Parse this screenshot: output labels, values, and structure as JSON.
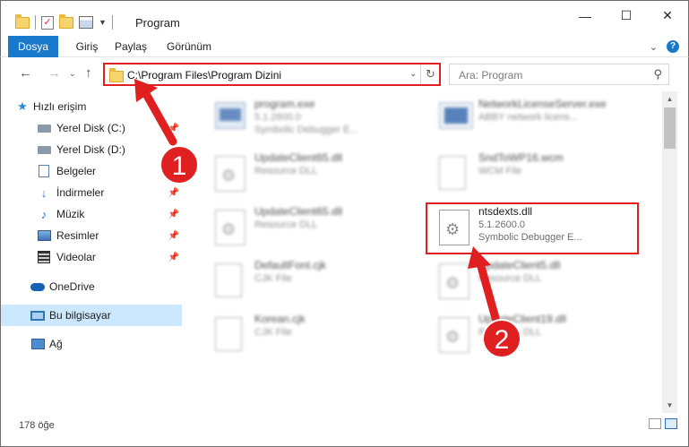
{
  "window": {
    "title": "Program",
    "minimize": "—",
    "maximize": "☐",
    "close": "✕"
  },
  "ribbon": {
    "tabs": [
      {
        "label": "Dosya",
        "active": true
      },
      {
        "label": "Giriş"
      },
      {
        "label": "Paylaş"
      },
      {
        "label": "Görünüm"
      }
    ],
    "help": "?"
  },
  "nav": {
    "back": "←",
    "forward": "→",
    "up": "↑",
    "address": "C:\\Program Files\\Program Dizini",
    "refresh": "↻",
    "search_placeholder": "Ara: Program",
    "search_icon": "search-icon"
  },
  "sidebar": {
    "items": [
      {
        "label": "Hızlı erişim",
        "icon": "star-icon"
      },
      {
        "label": "Yerel Disk (C:)",
        "icon": "drive-icon",
        "pinned": true
      },
      {
        "label": "Yerel Disk (D:)",
        "icon": "drive-icon"
      },
      {
        "label": "Belgeler",
        "icon": "document-icon",
        "pinned": true
      },
      {
        "label": "İndirmeler",
        "icon": "download-icon",
        "pinned": true
      },
      {
        "label": "Müzik",
        "icon": "music-icon",
        "pinned": true
      },
      {
        "label": "Resimler",
        "icon": "picture-icon",
        "pinned": true
      },
      {
        "label": "Videolar",
        "icon": "video-icon",
        "pinned": true
      },
      {
        "label": "OneDrive",
        "icon": "cloud-icon"
      },
      {
        "label": "Bu bilgisayar",
        "icon": "computer-icon",
        "selected": true
      },
      {
        "label": "Ağ",
        "icon": "network-icon"
      }
    ]
  },
  "files": [
    {
      "name": "program.exe",
      "desc": "5.1.2600.0",
      "type": "Symbolic Debugger E...",
      "icon": "exe-icon"
    },
    {
      "name": "NetworkLicenseServer.exe",
      "desc": "ABBY network licens...",
      "type": "",
      "icon": "net-exe-icon"
    },
    {
      "name": "UpdateClient65.dll",
      "desc": "Resource DLL",
      "type": "",
      "icon": "dll-icon"
    },
    {
      "name": "SndToWP16.wcm",
      "desc": "WCM File",
      "type": "",
      "icon": "document-icon"
    },
    {
      "name": "UpdateClient65.dll",
      "desc": "Resource DLL",
      "type": "",
      "icon": "dll-icon"
    },
    {
      "name": "ntsdexts.dll",
      "desc": "5.1.2600.0",
      "type": "Symbolic Debugger E...",
      "icon": "dll-icon",
      "highlighted": true
    },
    {
      "name": "DefaultFont.cjk",
      "desc": "CJK File",
      "type": "",
      "icon": "document-icon"
    },
    {
      "name": "UpdateClient5.dll",
      "desc": "Resource DLL",
      "type": "",
      "icon": "dll-icon"
    },
    {
      "name": "Korean.cjk",
      "desc": "CJK File",
      "type": "",
      "icon": "document-icon"
    },
    {
      "name": "UpdateClient19.dll",
      "desc": "Resource DLL",
      "type": "",
      "icon": "dll-icon"
    }
  ],
  "status": {
    "count": "178 öğe"
  },
  "annotations": {
    "step1": "1",
    "step2": "2",
    "color": "#e02020"
  }
}
